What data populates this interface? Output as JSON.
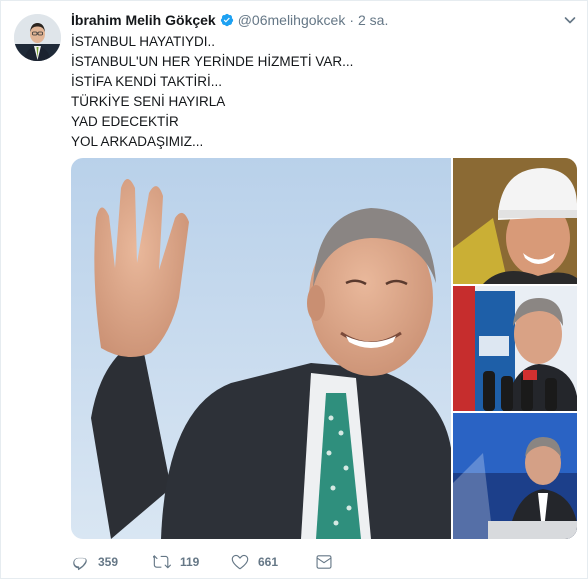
{
  "tweet": {
    "author": {
      "name": "İbrahim Melih Gökçek",
      "handle": "@06melihgokcek",
      "verified": true,
      "avatar": "user-avatar-photo"
    },
    "separator": "·",
    "timestamp": "2 sa.",
    "text_lines": [
      "İSTANBUL HAYATIYDI..",
      "İSTANBUL'UN HER YERİNDE HİZMETİ VAR...",
      "İSTİFA KENDİ TAKTİRİ...",
      "TÜRKİYE SENİ HAYIRLA",
      "YAD EDECEKTİR",
      "YOL ARKADAŞIMIZ..."
    ],
    "media": [
      {
        "description": "waving-man-photo"
      },
      {
        "description": "hard-hat-man-photo"
      },
      {
        "description": "man-at-microphones-photo"
      },
      {
        "description": "man-at-podium-photo"
      }
    ],
    "actions": {
      "reply_count": "359",
      "retweet_count": "119",
      "like_count": "661",
      "icons": [
        "reply-icon",
        "retweet-icon",
        "like-icon",
        "direct-message-icon"
      ]
    }
  },
  "colors": {
    "text": "#14171a",
    "secondary": "#657786",
    "verified": "#1da1f2",
    "border": "#e6ecf0"
  }
}
